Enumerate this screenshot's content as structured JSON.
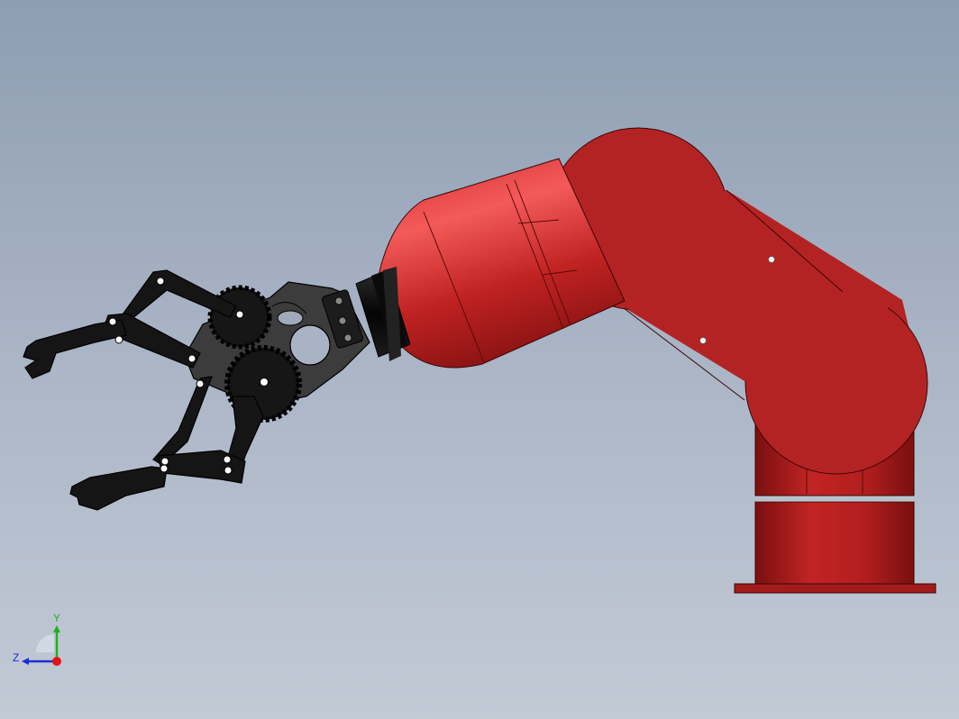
{
  "viewport": {
    "background_top": "#8e9db2",
    "background_bottom": "#c3cad6"
  },
  "colors": {
    "arm_red": "#b22222",
    "arm_red_light": "#f05050",
    "gripper_black": "#151515",
    "gripper_plate": "#3a3a3a"
  },
  "triad": {
    "y_label": "Y",
    "z_label": "Z",
    "y_color": "#1db31d",
    "z_color": "#1a2fd6",
    "x_color": "#e01515"
  }
}
